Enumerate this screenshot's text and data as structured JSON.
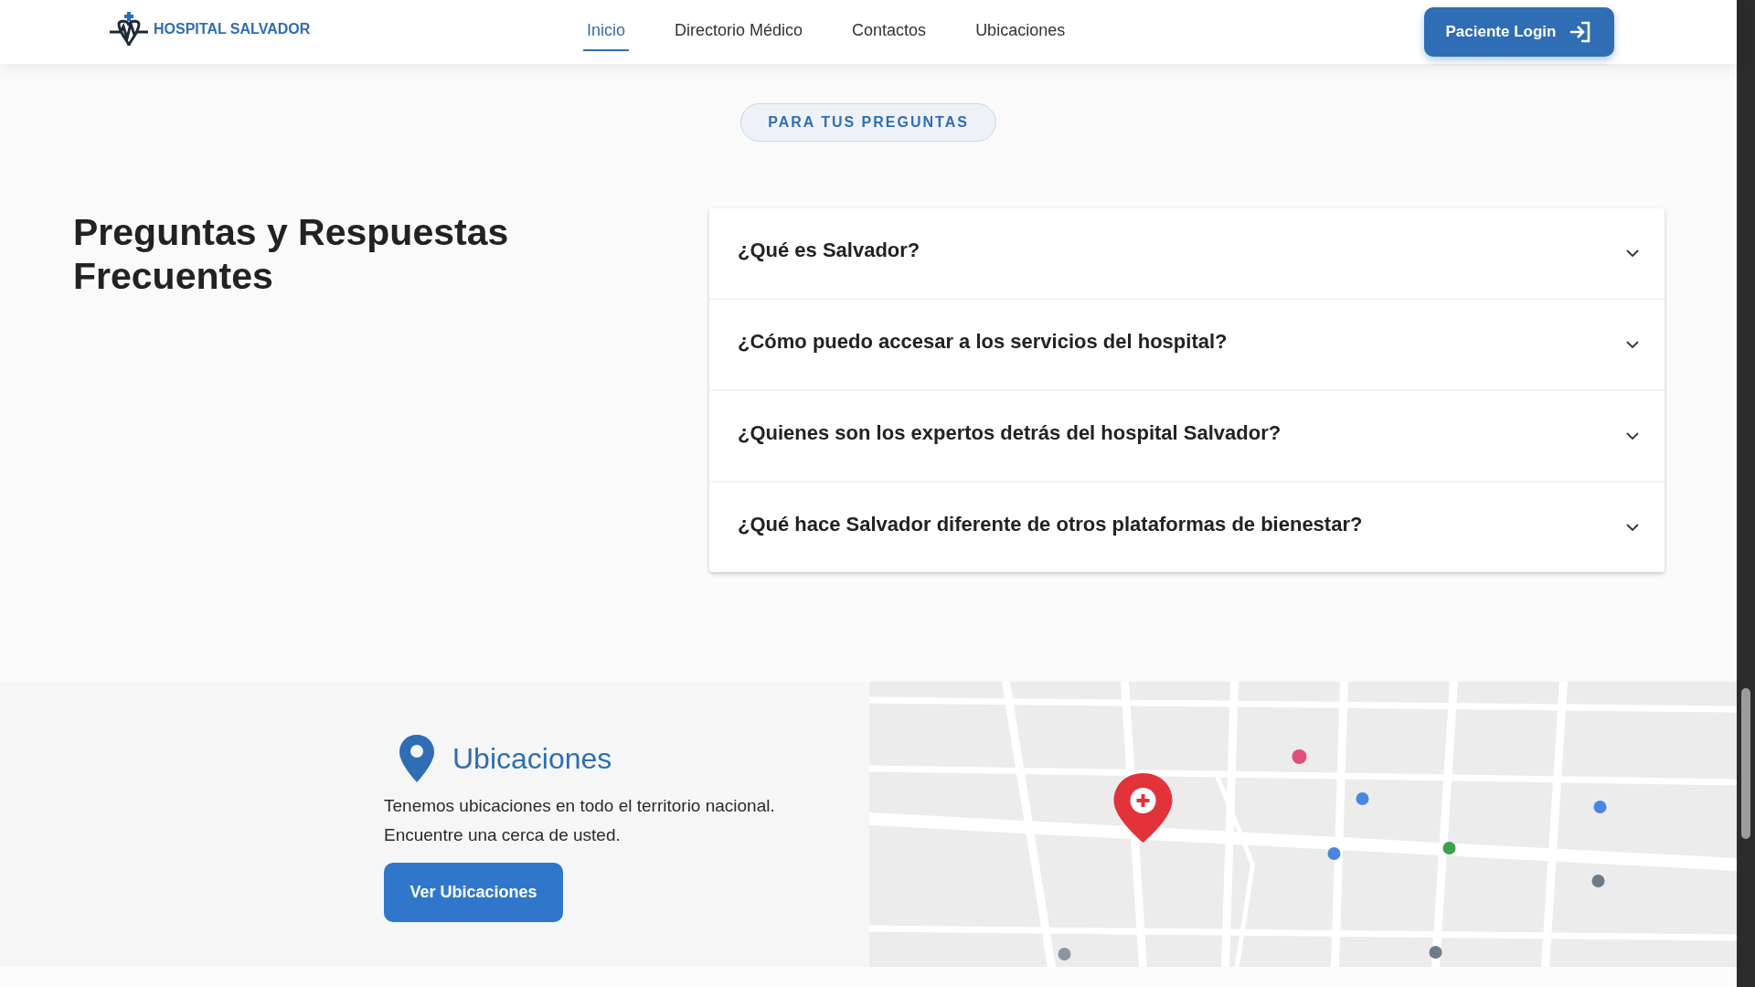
{
  "header": {
    "brand": "HOSPITAL SALVADOR",
    "nav": [
      {
        "label": "Inicio",
        "selected": true
      },
      {
        "label": "Directorio Médico",
        "selected": false
      },
      {
        "label": "Contactos",
        "selected": false
      },
      {
        "label": "Ubicaciones",
        "selected": false
      }
    ],
    "login_button": "Paciente Login"
  },
  "faq": {
    "badge": "PARA TUS PREGUNTAS",
    "title": "Preguntas y Respuestas Frecuentes",
    "items": [
      {
        "question": "¿Qué es Salvador?",
        "expanded": false
      },
      {
        "question": "¿Cómo puedo accesar a los servicios del hospital?",
        "expanded": false
      },
      {
        "question": "¿Quienes son los expertos detrás del hospital Salvador?",
        "expanded": false
      },
      {
        "question": "¿Qué hace Salvador diferente de otros plataformas de bienestar?",
        "expanded": false
      }
    ]
  },
  "locations": {
    "title": "Ubicaciones",
    "text": "Tenemos ubicaciones en todo el territorio nacional. Encuentre una cerca de usted.",
    "button": "Ver Ubicaciones"
  }
}
